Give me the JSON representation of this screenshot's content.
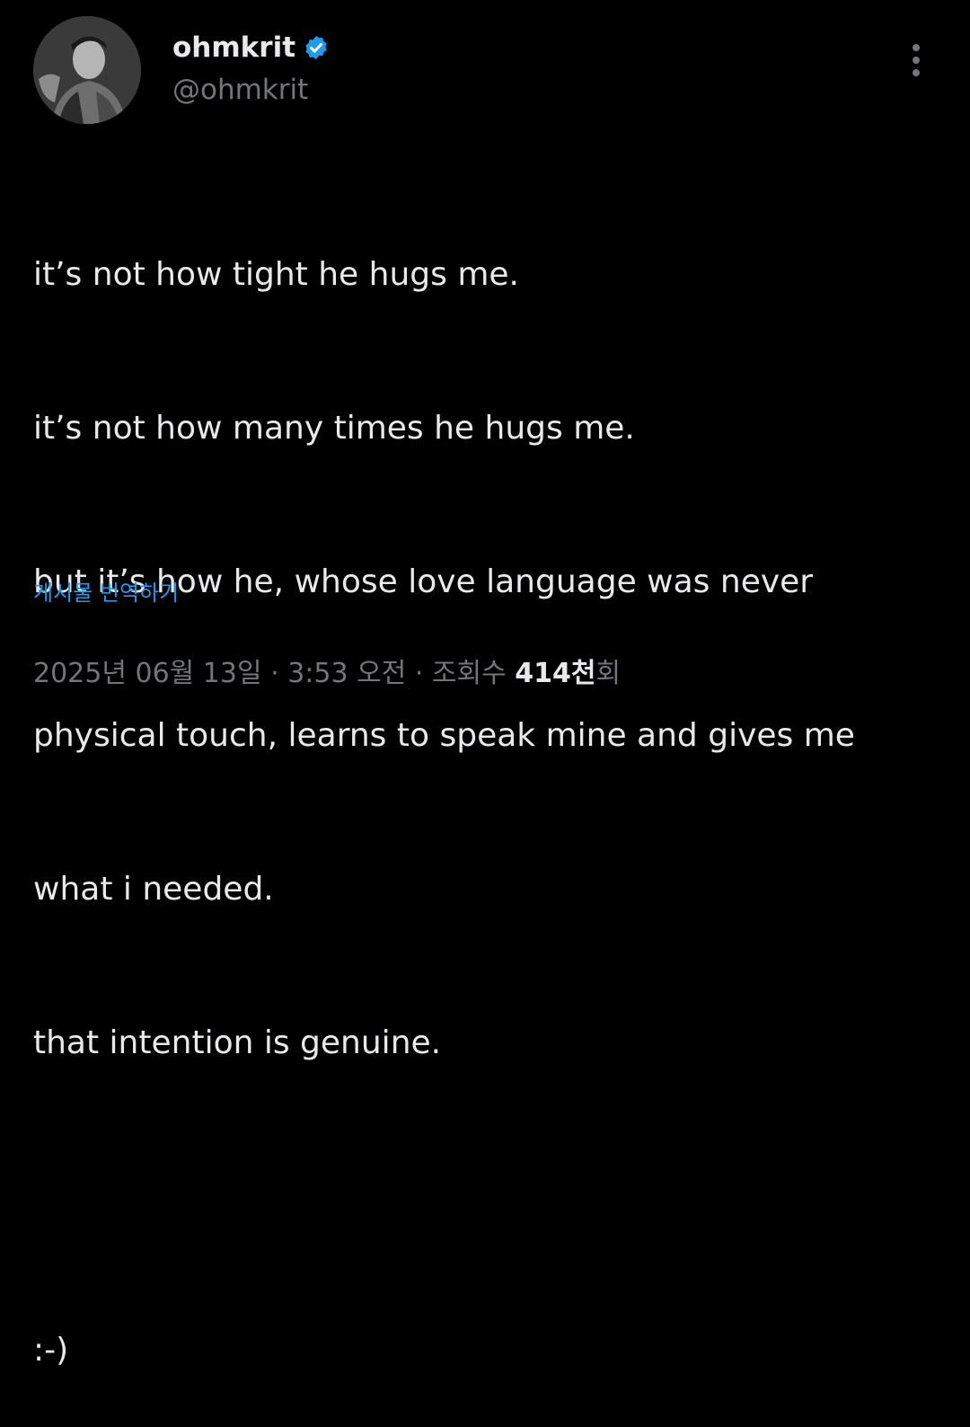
{
  "author": {
    "display_name": "ohmkrit",
    "handle": "@ohmkrit",
    "verified": true
  },
  "icons": {
    "verified": "verified-badge-icon",
    "more": "more-options-icon"
  },
  "tweet": {
    "lines": [
      "it’s not how tight he hugs me.",
      "it’s not how many times he hugs me.",
      "but it’s how he, whose love language was never",
      "physical touch, learns to speak mine and gives me",
      "what i needed.",
      "that intention is genuine.",
      "",
      ":-)"
    ]
  },
  "translate_label": "게시물 번역하기",
  "meta": {
    "date": "2025년 06월 13일",
    "separator": " · ",
    "time": "3:53 오전",
    "views_label": "조회수",
    "views_count": "414천",
    "views_suffix": "회"
  },
  "colors": {
    "background": "#000000",
    "text_primary": "#e7e9ea",
    "text_secondary": "#71767b",
    "accent": "#1d9bf0"
  }
}
